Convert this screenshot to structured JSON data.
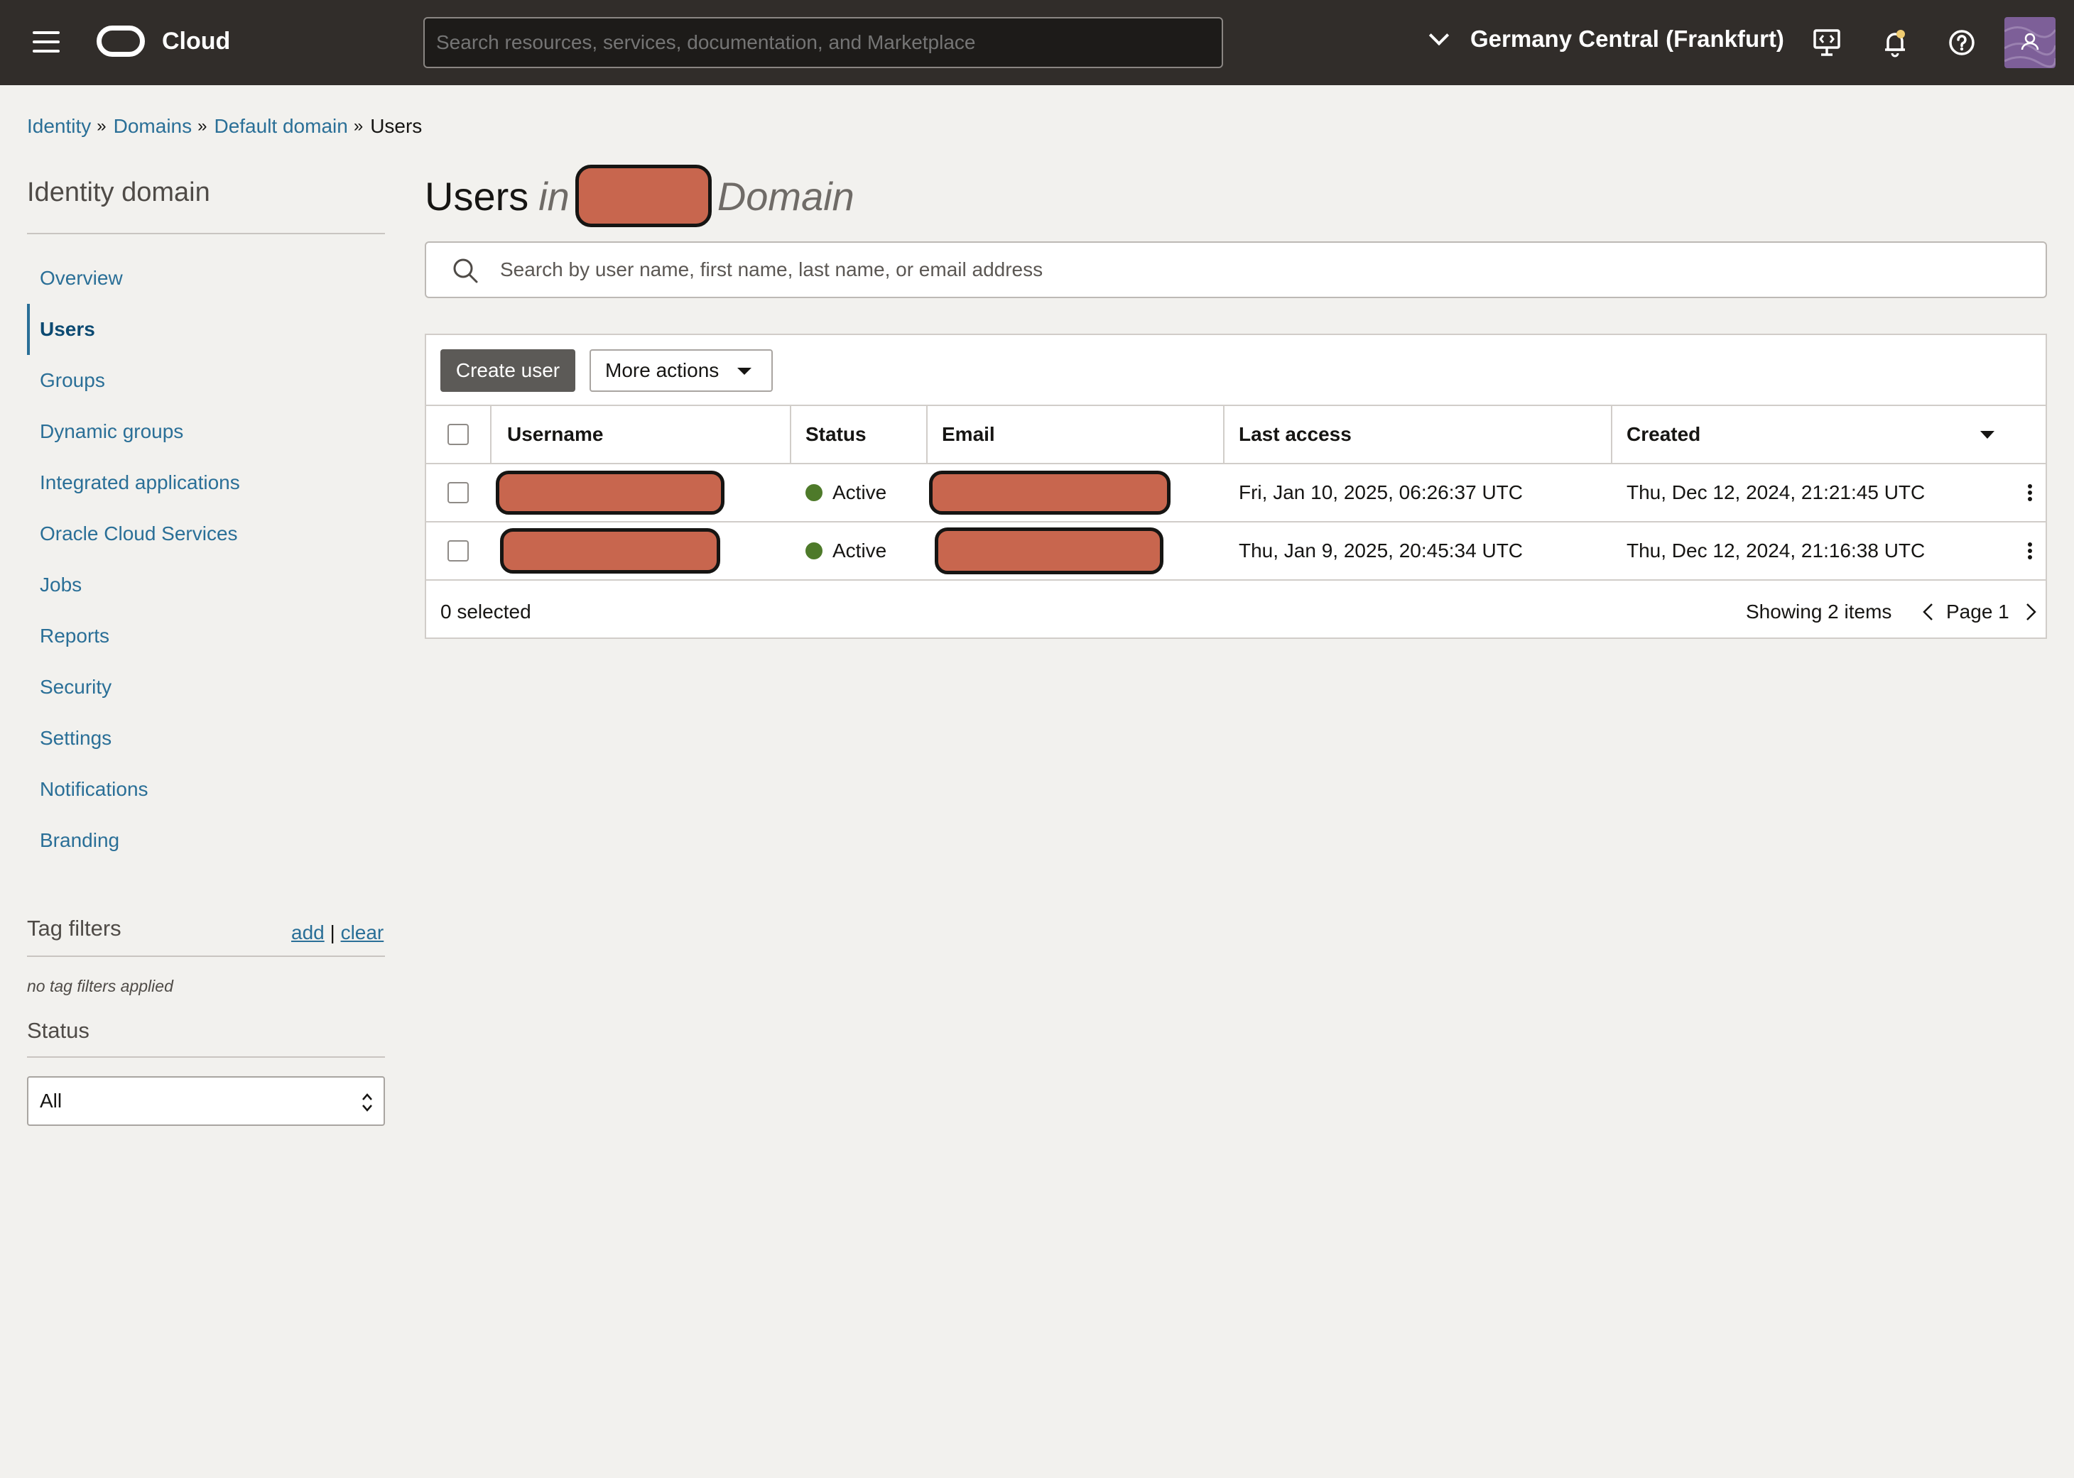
{
  "header": {
    "brand": "Cloud",
    "search_placeholder": "Search resources, services, documentation, and Marketplace",
    "region": "Germany Central (Frankfurt)",
    "icons": [
      "menu-icon",
      "developer-tools-icon",
      "bell-icon",
      "help-icon",
      "profile-icon"
    ]
  },
  "breadcrumb": {
    "items": [
      "Identity",
      "Domains",
      "Default domain"
    ],
    "separator": "»",
    "current": "Users"
  },
  "sidebar": {
    "title": "Identity domain",
    "items": [
      {
        "label": "Overview",
        "active": false
      },
      {
        "label": "Users",
        "active": true
      },
      {
        "label": "Groups",
        "active": false
      },
      {
        "label": "Dynamic groups",
        "active": false
      },
      {
        "label": "Integrated applications",
        "active": false
      },
      {
        "label": "Oracle Cloud Services",
        "active": false
      },
      {
        "label": "Jobs",
        "active": false
      },
      {
        "label": "Reports",
        "active": false
      },
      {
        "label": "Security",
        "active": false
      },
      {
        "label": "Settings",
        "active": false
      },
      {
        "label": "Notifications",
        "active": false
      },
      {
        "label": "Branding",
        "active": false
      }
    ],
    "tag_filters": {
      "title": "Tag filters",
      "add": "add",
      "divider": "|",
      "clear": "clear",
      "empty": "no tag filters applied"
    },
    "status": {
      "title": "Status",
      "selected": "All"
    }
  },
  "main": {
    "title_prefix": "Users",
    "title_in": "in",
    "title_suffix": "Domain",
    "search_placeholder": "Search by user name, first name, last name, or email address",
    "create_button": "Create user",
    "more_actions": "More actions",
    "columns": [
      "Username",
      "Status",
      "Email",
      "Last access",
      "Created"
    ],
    "rows": [
      {
        "status": "Active",
        "last_access": "Fri, Jan 10, 2025, 06:26:37 UTC",
        "created": "Thu, Dec 12, 2024, 21:21:45 UTC"
      },
      {
        "status": "Active",
        "last_access": "Thu, Jan 9, 2025, 20:45:34 UTC",
        "created": "Thu, Dec 12, 2024, 21:16:38 UTC"
      }
    ],
    "footer": {
      "selected": "0 selected",
      "showing": "Showing 2 items",
      "page": "Page 1"
    }
  },
  "colors": {
    "topbar": "#312d2a",
    "link": "#2a6f97",
    "status_active": "#4e7a2a",
    "redaction": "#c8664e"
  }
}
